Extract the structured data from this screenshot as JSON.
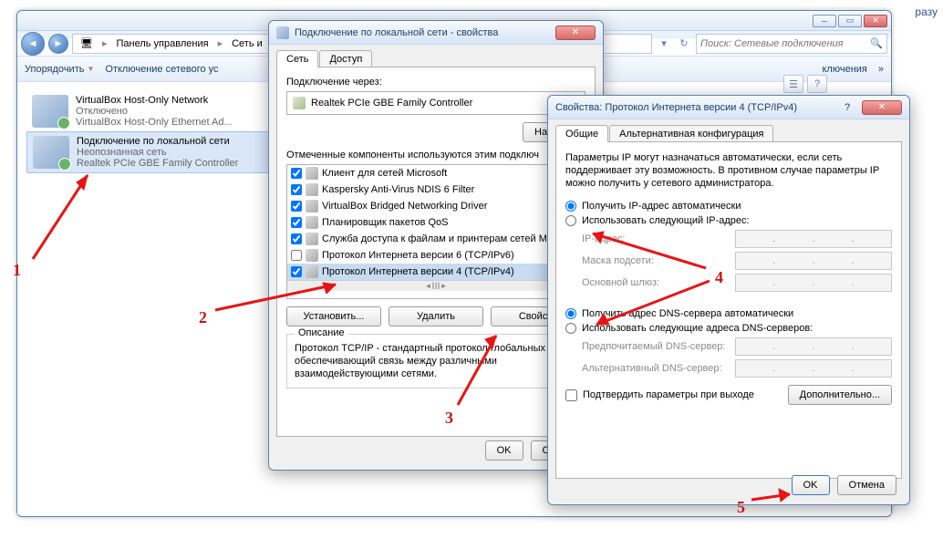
{
  "bg_text": "разу",
  "explorer": {
    "breadcrumb": {
      "item1": "Панель управления",
      "item2": "Сеть и"
    },
    "search_placeholder": "Поиск: Сетевые подключения",
    "toolbar": {
      "organize": "Упорядочить",
      "disable": "Отключение сетевого ус",
      "diag": "ключения",
      "chev": "»"
    },
    "adapters": [
      {
        "title": "VirtualBox Host-Only Network",
        "sub1": "Отключено",
        "sub2": "VirtualBox Host-Only Ethernet Ad..."
      },
      {
        "title": "Подключение по локальной сети",
        "sub1": "Неопознанная сеть",
        "sub2": "Realtek PCIe GBE Family Controller"
      }
    ]
  },
  "dlg1": {
    "title": "Подключение по локальной сети - свойства",
    "tabs": {
      "net": "Сеть",
      "access": "Доступ"
    },
    "conn_via": "Подключение через:",
    "conn_dev": "Realtek PCIe GBE Family Controller",
    "btn_config": "Настрои",
    "checked_label": "Отмеченные компоненты используются этим подключ",
    "components": [
      {
        "label": "Клиент для сетей Microsoft",
        "checked": true
      },
      {
        "label": "Kaspersky Anti-Virus NDIS 6 Filter",
        "checked": true
      },
      {
        "label": "VirtualBox Bridged Networking Driver",
        "checked": true
      },
      {
        "label": "Планировщик пакетов QoS",
        "checked": true
      },
      {
        "label": "Служба доступа к файлам и принтерам сетей M",
        "checked": true
      },
      {
        "label": "Протокол Интернета версии 6 (TCP/IPv6)",
        "checked": false
      },
      {
        "label": "Протокол Интернета версии 4 (TCP/IPv4)",
        "checked": true
      }
    ],
    "scroll_hint": "III",
    "btn_install": "Установить...",
    "btn_remove": "Удалить",
    "btn_props": "Свойств",
    "desc_title": "Описание",
    "desc": "Протокол TCP/IP - стандартный протокол глобальных сетей, обеспечивающий связь между различными взаимодействующими сетями.",
    "ok": "OK",
    "cancel": "Отмена"
  },
  "dlg2": {
    "title": "Свойства: Протокол Интернета версии 4 (TCP/IPv4)",
    "tabs": {
      "general": "Общие",
      "alt": "Альтернативная конфигурация"
    },
    "intro": "Параметры IP могут назначаться автоматически, если сеть поддерживает эту возможность. В противном случае параметры IP можно получить у сетевого администратора.",
    "r1": "Получить IP-адрес автоматически",
    "r2": "Использовать следующий IP-адрес:",
    "ip": "IP-адрес:",
    "mask": "Маска подсети:",
    "gw": "Основной шлюз:",
    "r3": "Получить адрес DNS-сервера автоматически",
    "r4": "Использовать следующие адреса DNS-серверов:",
    "dns1": "Предпочитаемый DNS-сервер:",
    "dns2": "Альтернативный DNS-сервер:",
    "confirm": "Подтвердить параметры при выходе",
    "adv": "Дополнительно...",
    "ok": "OK",
    "cancel": "Отмена"
  },
  "nums": {
    "n1": "1",
    "n2": "2",
    "n3": "3",
    "n4": "4",
    "n5": "5"
  }
}
